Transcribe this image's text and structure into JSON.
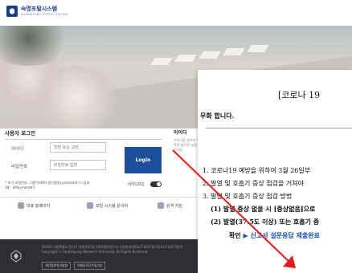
{
  "header": {
    "logo_ko": "숙명포털시스템",
    "logo_en": "SOOKMYUNG PORTAL SYSTEM"
  },
  "login": {
    "title": "사용자 로그인",
    "id_label": "아이디",
    "id_placeholder": "학번 또는 교번",
    "pw_label": "비밀번호",
    "pw_placeholder": "비밀번호 입력",
    "button_label": "Login",
    "note": "* 초기 비밀번호 : 대문자SM+생년월일(yymmdd)+느낌표 (예 : SMyymmdd!)",
    "id_save": "아이디저장"
  },
  "mid_column": {
    "title": "아이디",
    "text": "아이디을 잊어버 학생은 학번 재학생 교원/직원 : 인사팀"
  },
  "links": [
    {
      "label": "대표 홈페이지"
    },
    {
      "label": "포탈 시스템 문의처"
    },
    {
      "label": "원격 지원"
    }
  ],
  "footer": {
    "text1": "04310 서울특별시 용산구 청파로47길 100(청파동2가) 숙명여자대학교 T.02)710-9114 F.02)710-9",
    "text2": "Copyright ⓒ Sookmyung Women's University. All Rights Reserved.",
    "btn_privacy": "개인정보처리방침",
    "btn_email": "이메일무단수집거부"
  },
  "popup": {
    "title": "[코로나 19",
    "line1a": "무화 합니다.",
    "line1": "1. 코로나19 예방을 위하여 3월 26일부",
    "line2": "2. 발열 및 호흡기 증상 점검을 거쳐야",
    "line3": "3. 발열 및 호흡기 증상 점검 방법",
    "line4": "(1) 발열 증상 없을 시 [증상없음]으로",
    "line5": "(2) 발열(37.5도 이상) 또는 호흡기 증",
    "line6_prefix": "확인 ",
    "line6_blue": "▶ 신고서 설문응답 제출완료"
  }
}
